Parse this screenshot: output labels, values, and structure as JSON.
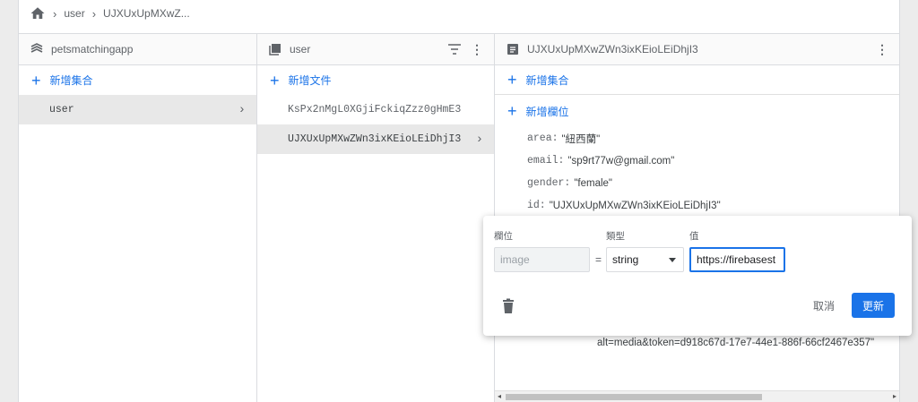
{
  "breadcrumb": {
    "items": [
      "user",
      "UJXUxUpMXwZ..."
    ]
  },
  "col1": {
    "title": "petsmatchingapp",
    "add_label": "新增集合",
    "items": [
      "user"
    ]
  },
  "col2": {
    "title": "user",
    "add_label": "新增文件",
    "items": [
      "KsPx2nMgL0XGjiFckiqZzz0gHmE3",
      "UJXUxUpMXwZWn3ixKEioLEiDhjI3"
    ]
  },
  "col3": {
    "title": "UJXUxUpMXwZWn3ixKEioLEiDhjI3",
    "add_collection": "新增集合",
    "add_field": "新增欄位",
    "fields": [
      {
        "key": "area:",
        "value": "\"紐西蘭\""
      },
      {
        "key": "email:",
        "value": "\"sp9rt77w@gmail.com\""
      },
      {
        "key": "gender:",
        "value": "\"female\""
      },
      {
        "key": "id:",
        "value": "\"UJXUxUpMXwZWn3ixKEioLEiDhjI3\""
      }
    ],
    "overflow_text": "alt=media&token=d918c67d-17e7-44e1-886f-66cf2467e357\""
  },
  "dialog": {
    "field_label": "欄位",
    "type_label": "類型",
    "value_label": "值",
    "field_placeholder": "image",
    "equals": "=",
    "type_value": "string",
    "value_value": "https://firebasest",
    "cancel": "取消",
    "update": "更新"
  },
  "icons": [
    "home-icon",
    "collection-icon",
    "document-icon",
    "filter-icon",
    "more-vert-icon",
    "delete-icon"
  ],
  "colors": {
    "accent": "#1a73e8",
    "selected_row": "#e8e8e8"
  }
}
